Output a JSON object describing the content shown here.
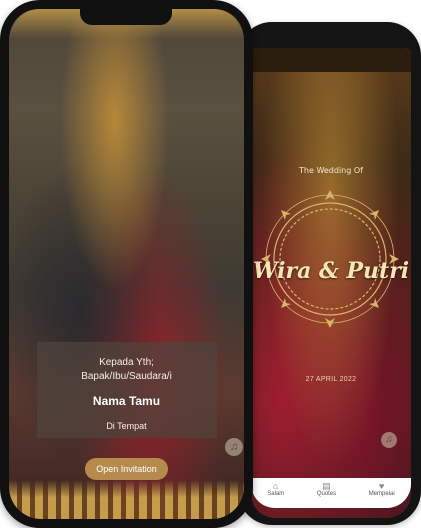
{
  "back_phone": {
    "wedding_label": "The Wedding Of",
    "couple": "Wira & Putri",
    "date": "27 APRIL 2022",
    "music_icon": "music-note-icon",
    "nav": [
      {
        "label": "Salam",
        "icon": "home-icon"
      },
      {
        "label": "Quotes",
        "icon": "quote-icon"
      },
      {
        "label": "Mempelai",
        "icon": "heart-icon"
      }
    ]
  },
  "front_phone": {
    "greeting_line1": "Kepada Yth;",
    "greeting_line2": "Bapak/Ibu/Saudara/i",
    "guest_name": "Nama Tamu",
    "location": "Di Tempat",
    "open_button": "Open Invitation",
    "music_icon": "music-note-icon"
  },
  "colors": {
    "gold": "#b58a4c",
    "frame": "#101010",
    "navbar": "#ffffff"
  }
}
